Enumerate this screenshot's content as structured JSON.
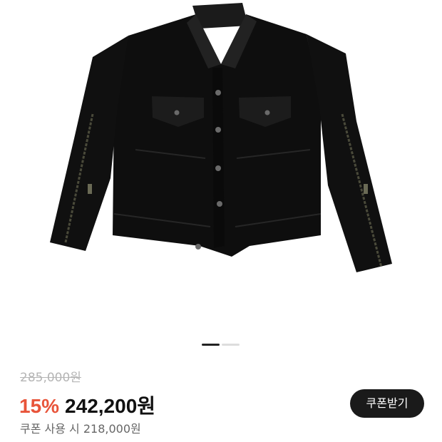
{
  "product": {
    "image_icon": "black-jacket-image",
    "gallery": {
      "active_index": 0,
      "total": 2
    }
  },
  "pricing": {
    "original_price": "285,000원",
    "discount_rate": "15%",
    "sale_price": "242,200원",
    "coupon_price_text": "쿠폰 사용 시 218,000원",
    "coupon_button_label": "쿠폰받기",
    "discount_color": "#e8543a",
    "button_color": "#1a1a1a"
  }
}
